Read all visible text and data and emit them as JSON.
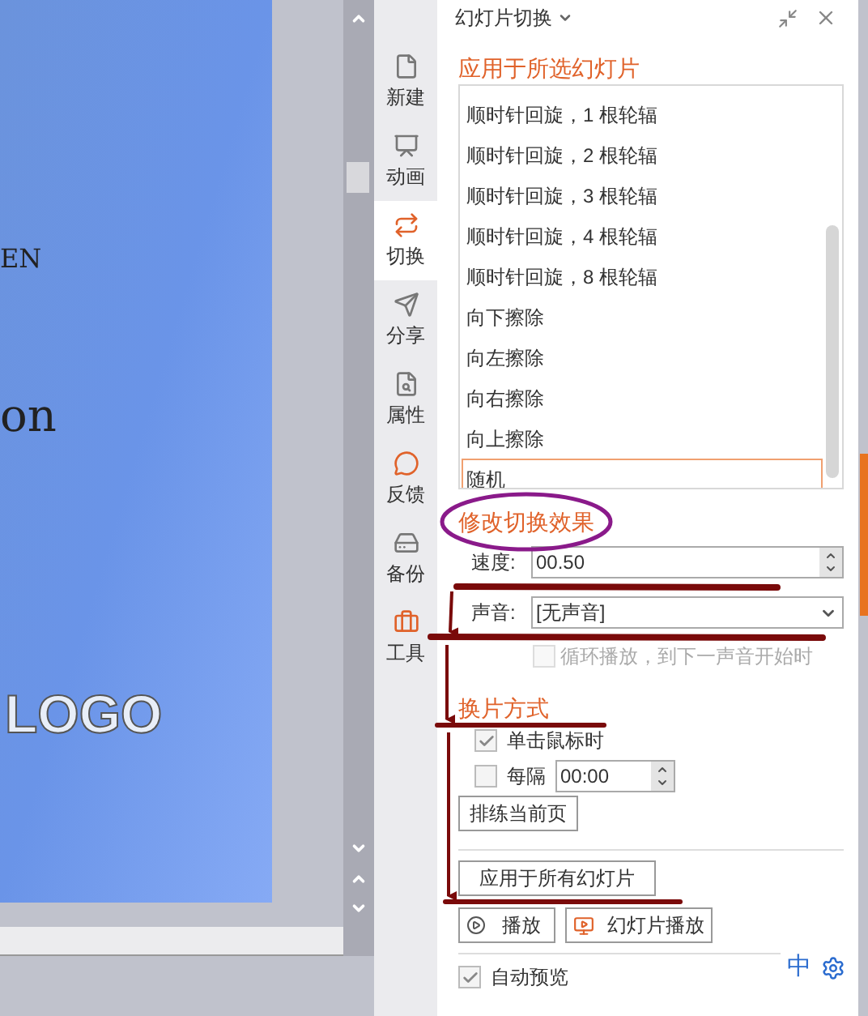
{
  "slide": {
    "texts": [
      {
        "kind": "heading",
        "text": "EN"
      },
      {
        "kind": "title",
        "text": "on"
      },
      {
        "kind": "logo",
        "text": "LOGO"
      }
    ]
  },
  "sidebar": {
    "items": [
      {
        "label": "新建",
        "selected": false
      },
      {
        "label": "动画",
        "selected": false
      },
      {
        "label": "切换",
        "selected": true
      },
      {
        "label": "分享",
        "selected": false
      },
      {
        "label": "属性",
        "selected": false
      },
      {
        "label": "反馈",
        "selected": false
      },
      {
        "label": "备份",
        "selected": false
      },
      {
        "label": "工具",
        "selected": false
      }
    ]
  },
  "panel": {
    "title": "幻灯片切换",
    "apply_heading": "应用于所选幻灯片",
    "transitions": [
      {
        "label": "顺时针回旋，1 根轮辐",
        "selected": false
      },
      {
        "label": "顺时针回旋，2 根轮辐",
        "selected": false
      },
      {
        "label": "顺时针回旋，3 根轮辐",
        "selected": false
      },
      {
        "label": "顺时针回旋，4 根轮辐",
        "selected": false
      },
      {
        "label": "顺时针回旋，8 根轮辐",
        "selected": false
      },
      {
        "label": "向下擦除",
        "selected": false
      },
      {
        "label": "向左擦除",
        "selected": false
      },
      {
        "label": "向右擦除",
        "selected": false
      },
      {
        "label": "向上擦除",
        "selected": false
      },
      {
        "label": "随机",
        "selected": true
      }
    ],
    "effect_heading": "修改切换效果",
    "speed": {
      "label": "速度:",
      "value": "00.50"
    },
    "sound": {
      "label": "声音:",
      "value": "[无声音]"
    },
    "loop": {
      "label": "循环播放，到下一声音开始时",
      "checked": false,
      "disabled": true
    },
    "advance_heading": "换片方式",
    "on_click": {
      "label": "单击鼠标时",
      "checked": true
    },
    "every": {
      "label": "每隔",
      "checked": false,
      "value": "00:00"
    },
    "rehearse_button": "排练当前页",
    "apply_all_button": "应用于所有幻灯片",
    "play_button": "播放",
    "slideshow_button": "幻灯片播放",
    "auto_preview": {
      "label": "自动预览",
      "checked": true
    }
  },
  "ime_toolbar": {
    "mode": "中"
  }
}
